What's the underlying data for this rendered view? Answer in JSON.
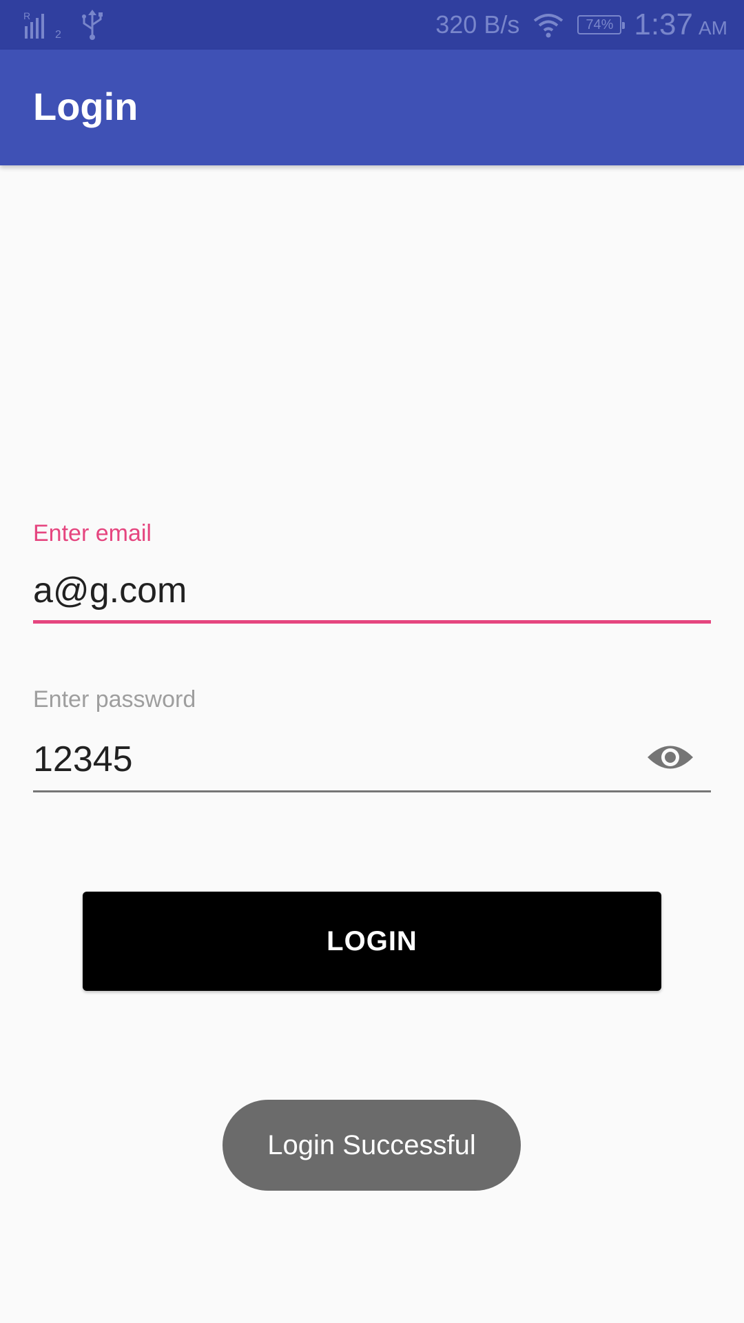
{
  "status_bar": {
    "net_speed": "320 B/s",
    "battery": "74%",
    "time": "1:37",
    "ampm": "AM",
    "signal_sub": "2",
    "icons": [
      "signal-icon",
      "usb-icon",
      "wifi-icon",
      "battery-icon"
    ]
  },
  "app_bar": {
    "title": "Login"
  },
  "email": {
    "label": "Enter email",
    "value": "a@g.com"
  },
  "password": {
    "label": "Enter password",
    "value": "12345"
  },
  "login_button": {
    "label": "LOGIN"
  },
  "toast": {
    "message": "Login Successful"
  },
  "colors": {
    "primary": "#3f51b5",
    "primary_dark": "#303f9f",
    "accent": "#e5457f",
    "status_icon": "#7986cb"
  }
}
